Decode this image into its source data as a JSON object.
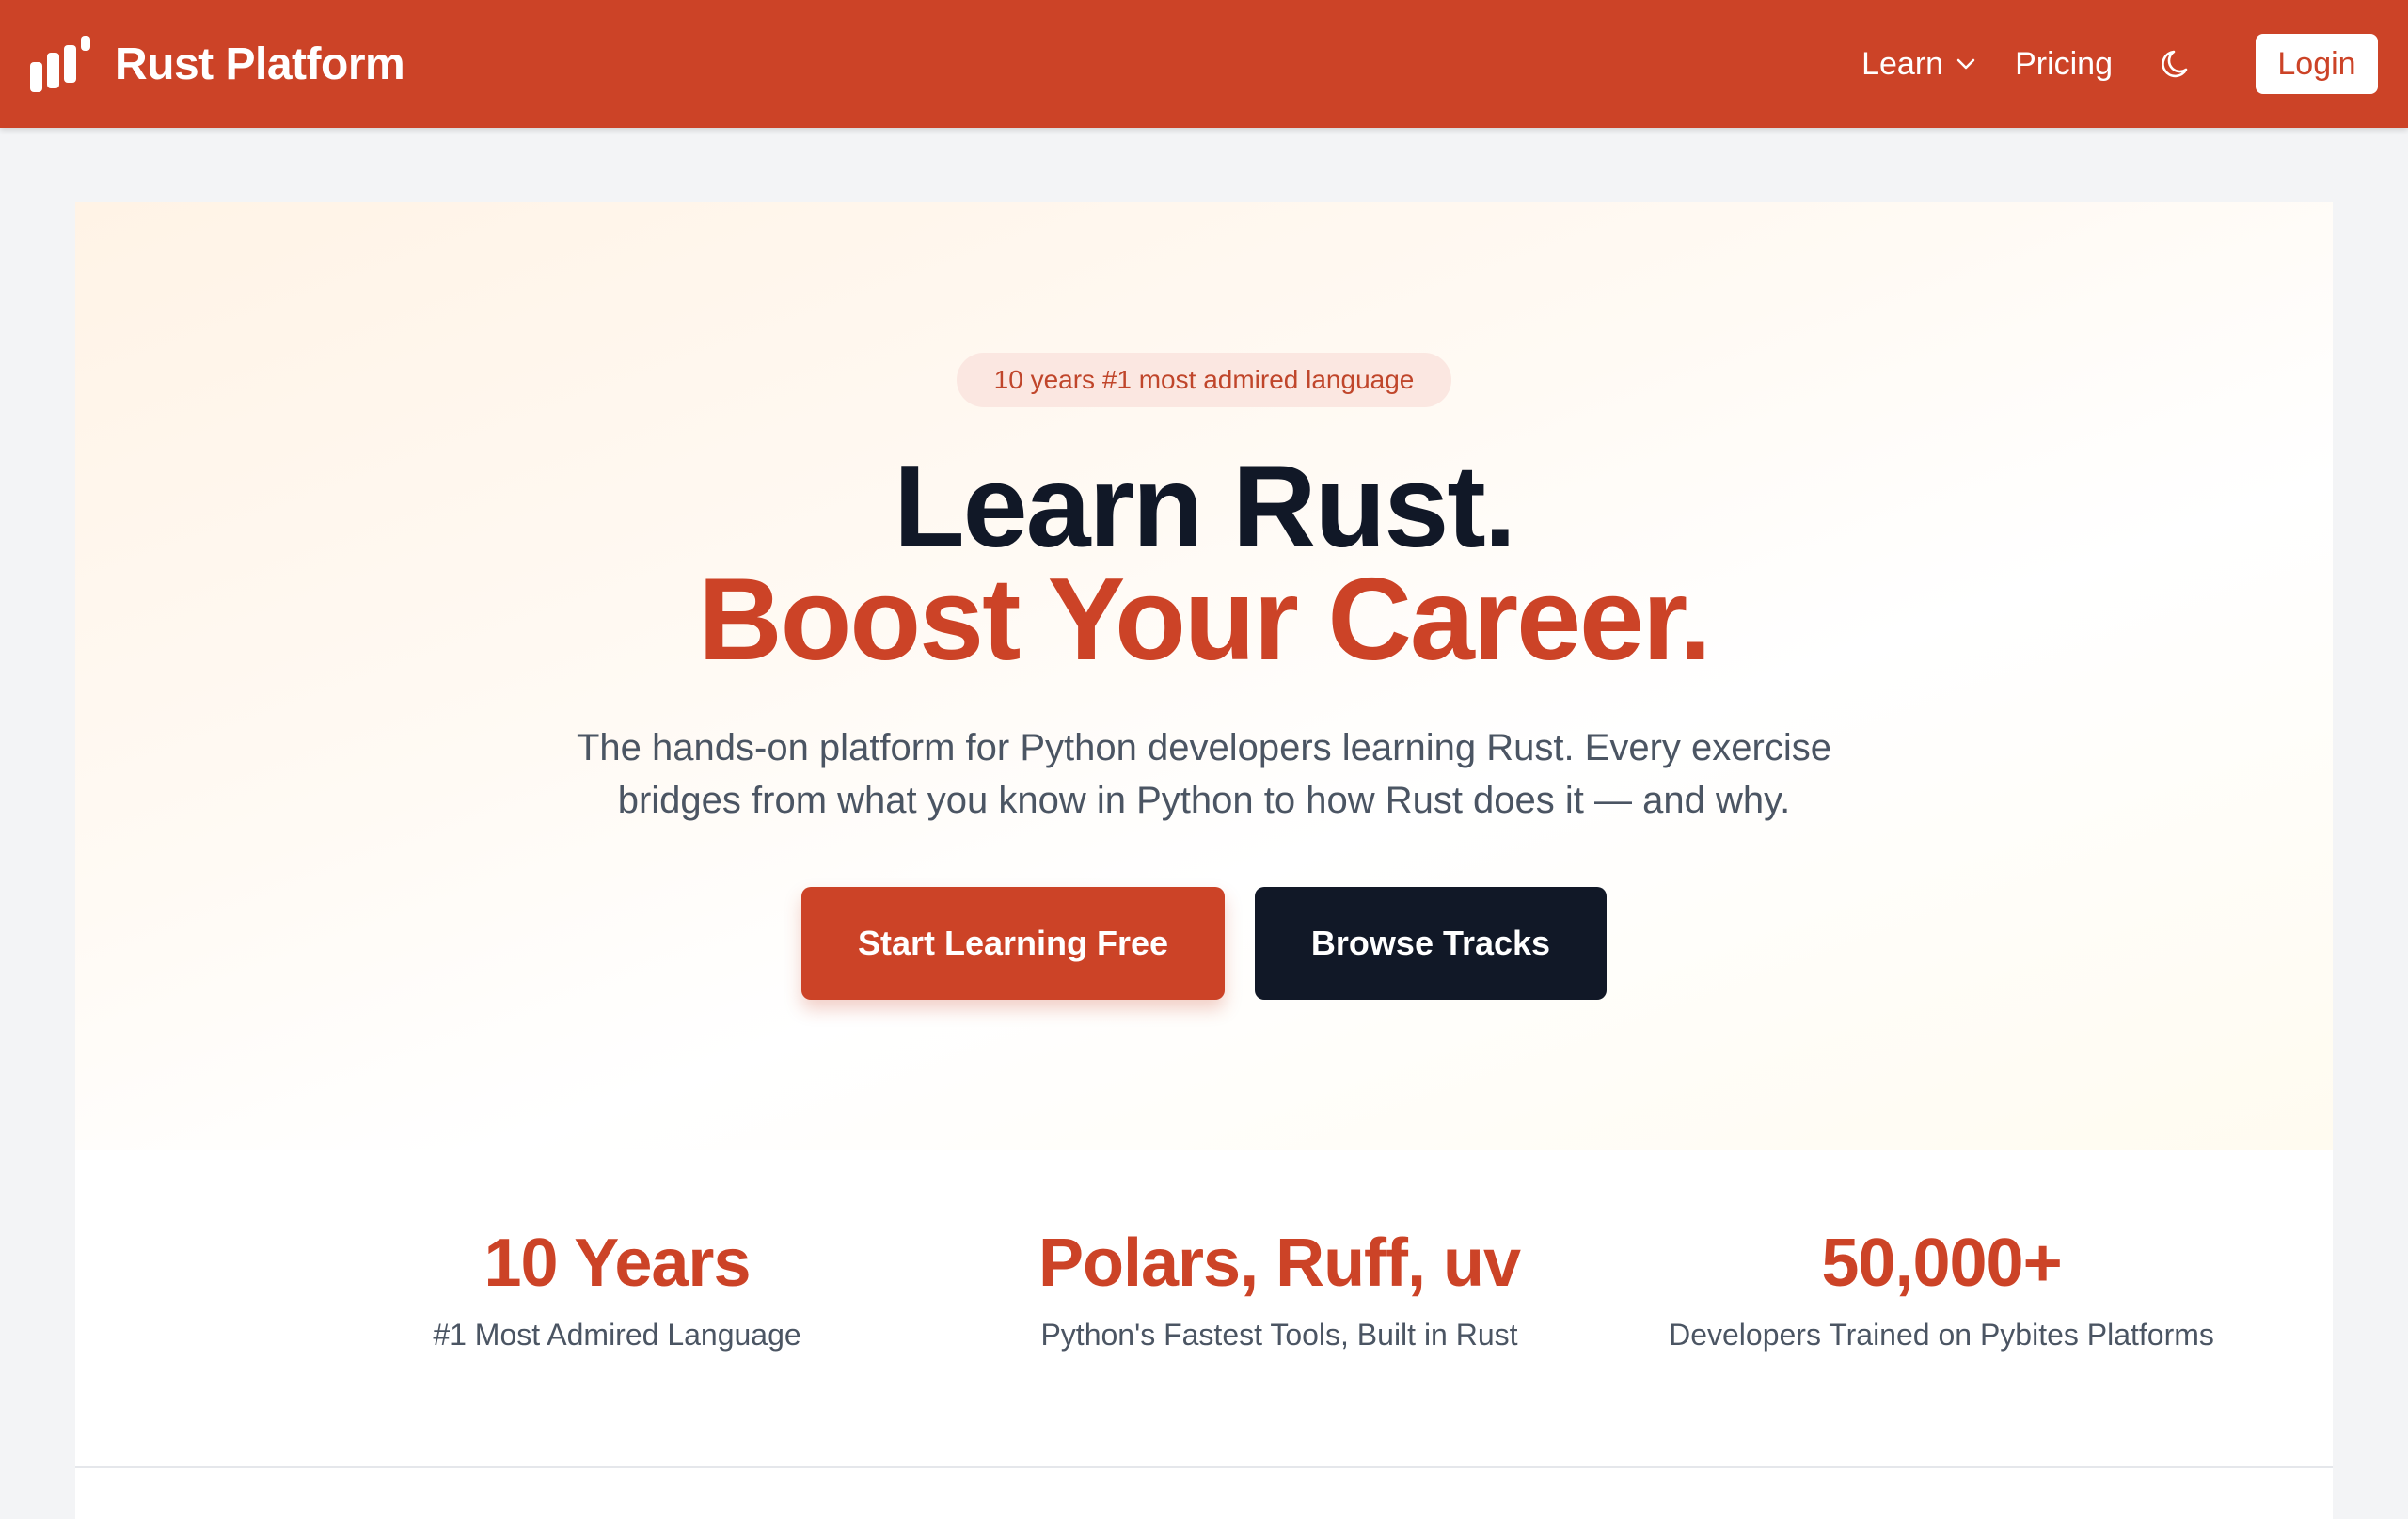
{
  "navbar": {
    "brand_name": "Rust Platform",
    "learn_label": "Learn",
    "pricing_label": "Pricing",
    "login_label": "Login",
    "brand_color": "#cc4327"
  },
  "hero": {
    "badge": "10 years #1 most admired language",
    "headline_line1": "Learn Rust.",
    "headline_line2": "Boost Your Career.",
    "subtitle_line1": "The hands-on platform for Python developers learning Rust. Every exercise",
    "subtitle_line2": "bridges from what you know in Python to how Rust does it — and why.",
    "primary_button": "Start Learning Free",
    "secondary_button": "Browse Tracks"
  },
  "stats": [
    {
      "value": "10 Years",
      "label": "#1 Most Admired Language"
    },
    {
      "value": "Polars, Ruff, uv",
      "label": "Python's Fastest Tools, Built in Rust"
    },
    {
      "value": "50,000+",
      "label": "Developers Trained on Pybites Platforms"
    }
  ],
  "icons": {
    "brand": "bar-chart-logo-icon",
    "learn_dropdown": "chevron-down-icon",
    "theme_toggle": "moon-icon"
  }
}
